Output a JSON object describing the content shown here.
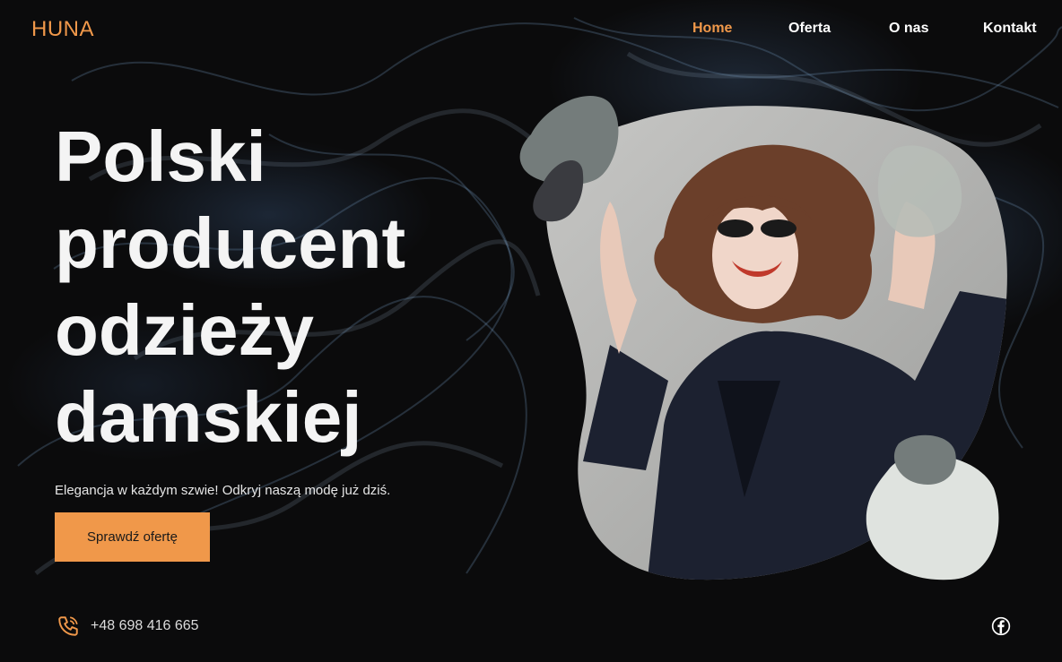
{
  "brand": {
    "logo": "HUNA"
  },
  "nav": {
    "items": [
      {
        "label": "Home",
        "active": true
      },
      {
        "label": "Oferta",
        "active": false
      },
      {
        "label": "O nas",
        "active": false
      },
      {
        "label": "Kontakt",
        "active": false
      }
    ]
  },
  "hero": {
    "title_lines": [
      "Polski",
      "producent",
      "odzieży",
      "damskiej"
    ],
    "subtitle": "Elegancja w każdym szwie! Odkryj naszą modę już dziś.",
    "cta_label": "Sprawdź ofertę"
  },
  "contact": {
    "phone": "+48 698 416 665",
    "phone_icon": "phone-icon",
    "social_icon": "facebook-icon"
  },
  "colors": {
    "accent": "#f0984a",
    "background": "#0b0b0c",
    "text": "#f4f4f4",
    "blob_gray": "#747c7b",
    "blob_dark": "#3a3b40",
    "blob_light": "#dfe3df",
    "blob_sage": "#b7bdb7"
  }
}
